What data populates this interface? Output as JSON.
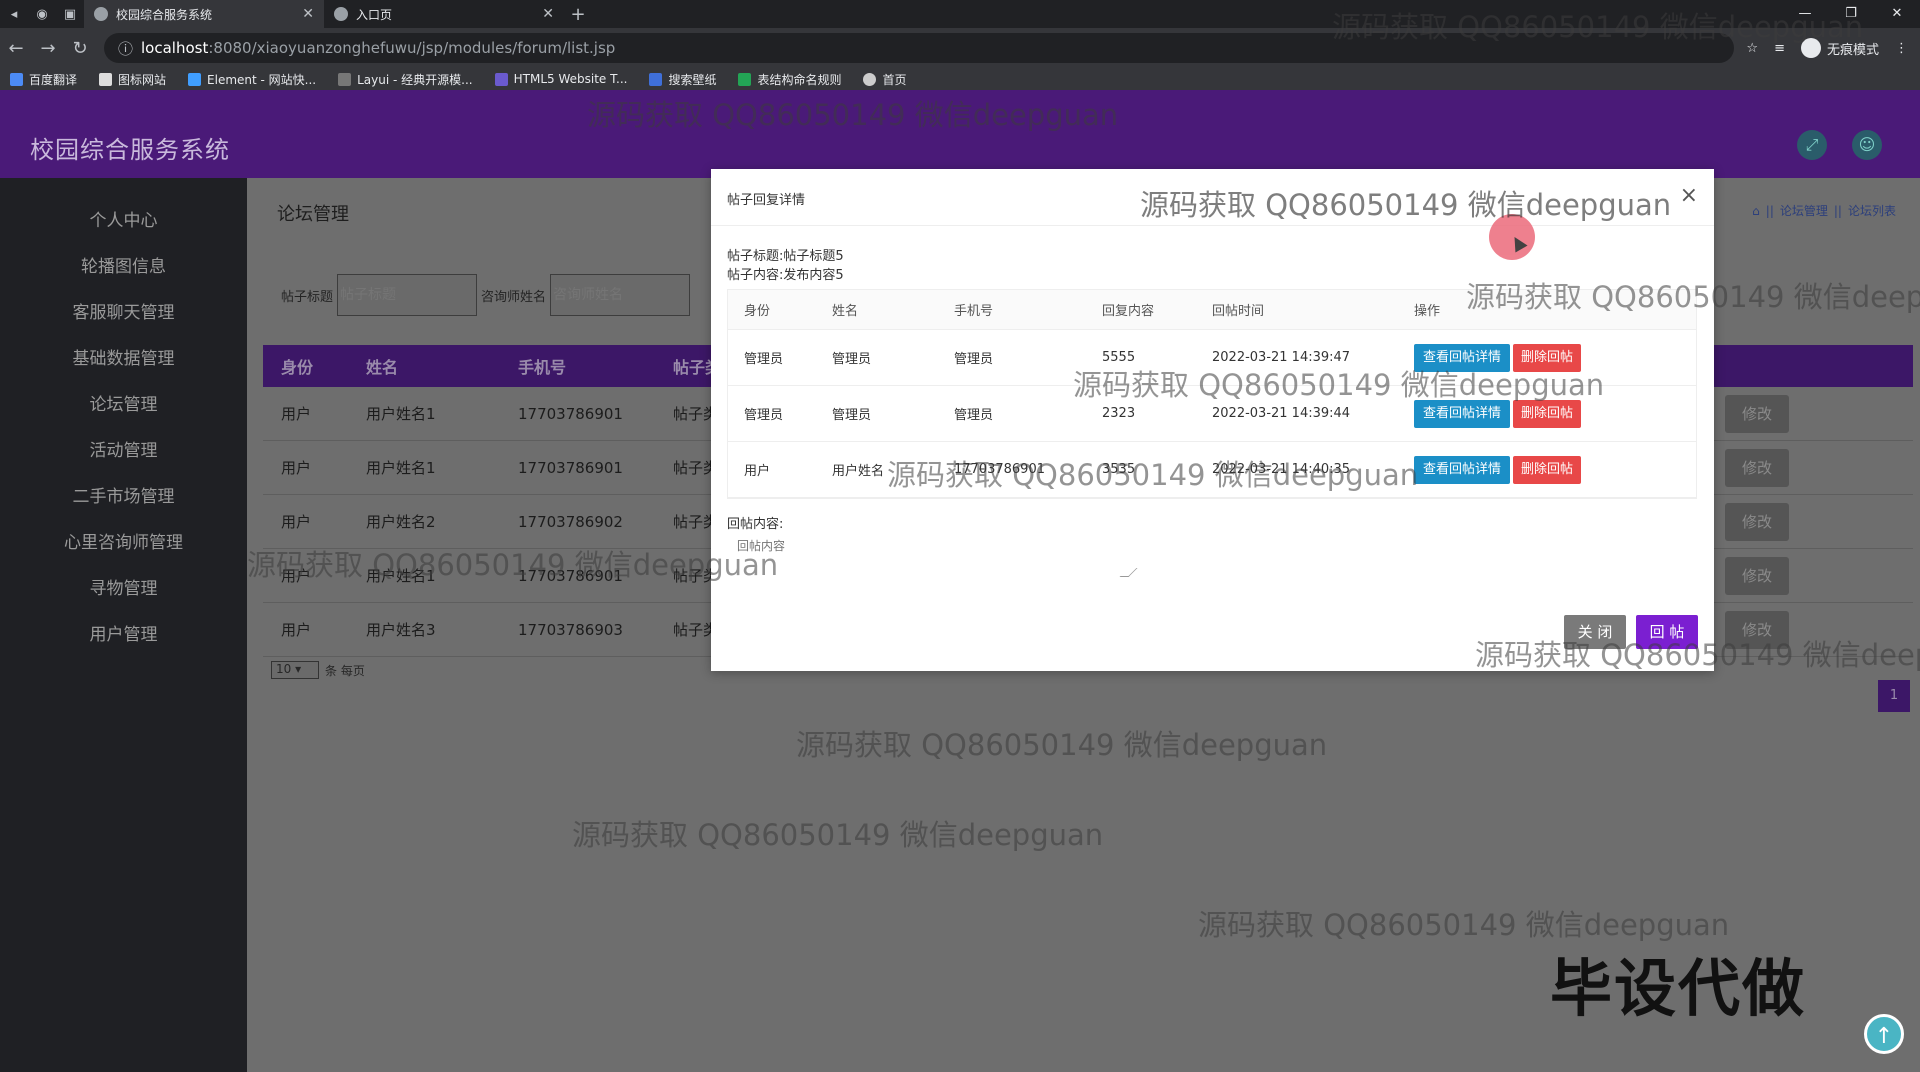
{
  "browser": {
    "tabs": [
      {
        "label": "校园综合服务系统",
        "active": true
      },
      {
        "label": "入口页",
        "active": false
      }
    ],
    "url_host": "localhost",
    "url_path": ":8080/xiaoyuanzonghefuwu/jsp/modules/forum/list.jsp",
    "profile_label": "无痕模式",
    "bookmarks": [
      "百度翻译",
      "图标网站",
      "Element - 网站快...",
      "Layui - 经典开源模...",
      "HTML5 Website T...",
      "搜索壁纸",
      "表结构命名规则",
      "首页"
    ]
  },
  "app": {
    "title": "校园综合服务系统"
  },
  "sidebar": {
    "items": [
      "个人中心",
      "轮播图信息",
      "客服聊天管理",
      "基础数据管理",
      "论坛管理",
      "活动管理",
      "二手市场管理",
      "心里咨询师管理",
      "寻物管理",
      "用户管理"
    ]
  },
  "main": {
    "page_title": "论坛管理",
    "breadcrumbs": [
      "论坛管理",
      "论坛列表"
    ],
    "search": {
      "label1": "帖子标题",
      "placeholder1": "帖子标题",
      "label2": "咨询师姓名",
      "placeholder2": "咨询师姓名"
    },
    "table": {
      "headers": [
        "身份",
        "姓名",
        "手机号",
        "帖子类"
      ],
      "rows": [
        {
          "role": "用户",
          "name": "用户姓名1",
          "phone": "17703786901",
          "type": "帖子类"
        },
        {
          "role": "用户",
          "name": "用户姓名1",
          "phone": "17703786901",
          "type": "帖子类"
        },
        {
          "role": "用户",
          "name": "用户姓名2",
          "phone": "17703786902",
          "type": "帖子类"
        },
        {
          "role": "用户",
          "name": "用户姓名1",
          "phone": "17703786901",
          "type": "帖子类"
        },
        {
          "role": "用户",
          "name": "用户姓名3",
          "phone": "17703786903",
          "type": "帖子类"
        }
      ],
      "edit_label": "修改"
    },
    "pager": {
      "size": "10",
      "suffix": "条 每页",
      "page": "1"
    }
  },
  "modal": {
    "title": "帖子回复详情",
    "post_title": "帖子标题:帖子标题5",
    "post_content": "帖子内容:发布内容5",
    "headers": [
      "身份",
      "姓名",
      "手机号",
      "回复内容",
      "回帖时间",
      "操作"
    ],
    "rows": [
      {
        "role": "管理员",
        "name": "管理员",
        "phone": "管理员",
        "content": "5555",
        "time": "2022-03-21 14:39:47"
      },
      {
        "role": "管理员",
        "name": "管理员",
        "phone": "管理员",
        "content": "2323",
        "time": "2022-03-21 14:39:44"
      },
      {
        "role": "用户",
        "name": "用户姓名",
        "phone": "17703786901",
        "content": "3535",
        "time": "2022-03-21 14:40:35"
      }
    ],
    "view_label": "查看回帖详情",
    "delete_label": "删除回帖",
    "reply_label": "回帖内容:",
    "reply_placeholder": "回帖内容",
    "close_label": "关 闭",
    "submit_label": "回 帖"
  },
  "watermarks": {
    "text": "源码获取 QQ86050149 微信deepguan",
    "stamp": "毕设代做"
  },
  "colors": {
    "header": "#4a1a78",
    "sidebar": "#1f2024",
    "primary_btn": "#7b1fd1",
    "view_btn": "#1b8fc7",
    "delete_btn": "#e84848"
  }
}
